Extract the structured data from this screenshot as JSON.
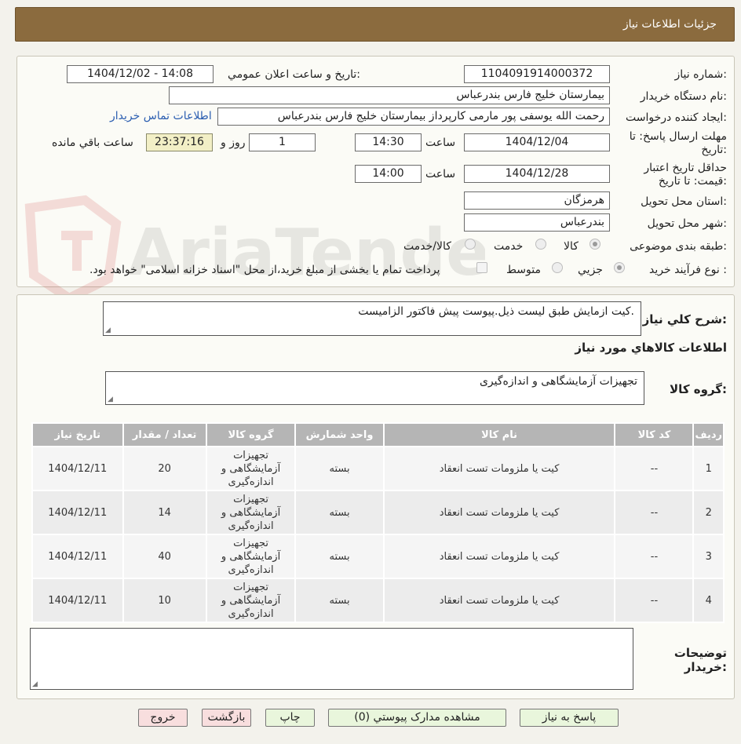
{
  "header": {
    "title": "جزئیات اطلاعات نیاز"
  },
  "form": {
    "need_number_label": "شماره نیاز:",
    "need_number": "1104091914000372",
    "announce_label": "تاریخ و ساعت اعلان عمومي:",
    "announce_value": "1404/12/02 - 14:08",
    "buyer_org_label": "نام دستگاه خريدار:",
    "buyer_org": "بیمارستان خلیج فارس بندرعباس",
    "creator_label": "ايجاد کننده درخواست:",
    "creator": "رحمت الله یوسفی پور مارمی کارپرداز بیمارستان خلیج فارس بندرعباس",
    "contact_link": "اطلاعات تماس خريدار",
    "deadline_label_line1": "مهلت ارسال پاسخ: تا",
    "deadline_label_line2": "تاريخ:",
    "deadline_date": "1404/12/04",
    "time_label": "ساعت",
    "deadline_time": "14:30",
    "days_value": "1",
    "days_label": "روز و",
    "remaining_time": "23:37:16",
    "remaining_label": "ساعت باقي مانده",
    "validity_label_line1": "حداقل تاريخ اعتبار",
    "validity_label_line2": "قيمت: تا تاريخ:",
    "validity_date": "1404/12/28",
    "validity_time": "14:00",
    "province_label": "استان محل تحويل:",
    "province": "هرمزگان",
    "city_label": "شهر محل تحويل:",
    "city": "بندرعباس",
    "category_label": "طبقه بندی موضوعی:",
    "category_options": [
      "کالا",
      "خدمت",
      "کالا/خدمت"
    ],
    "process_label": "نوع فرآيند خريد :",
    "process_options": [
      "جزيي",
      "متوسط"
    ],
    "payment_note": "پرداخت تمام يا بخشی از مبلغ خريد،از محل \"اسناد خزانه اسلامی\" خواهد بود."
  },
  "details": {
    "description_label": "شرح کلي نياز:",
    "description": "کیت ازمایش طبق لیست ذیل.پیوست پیش فاکتور الزامیست.",
    "goods_info_title": "اطلاعات کالاهاي مورد نياز",
    "goods_group_label": "گروه کالا:",
    "goods_group": "تجهیزات آزمایشگاهی و اندازه‌گیری",
    "table": {
      "headers": [
        "رديف",
        "کد کالا",
        "نام کالا",
        "واحد شمارش",
        "گروه کالا",
        "تعداد / مقدار",
        "تاريخ نياز"
      ],
      "rows": [
        [
          "1",
          "--",
          "کیت یا ملزومات تست انعقاد",
          "بسته",
          "تجهيزات آزمايشگاهی و اندازه‌گيری",
          "20",
          "1404/12/11"
        ],
        [
          "2",
          "--",
          "کیت یا ملزومات تست انعقاد",
          "بسته",
          "تجهيزات آزمايشگاهی و اندازه‌گيری",
          "14",
          "1404/12/11"
        ],
        [
          "3",
          "--",
          "کیت یا ملزومات تست انعقاد",
          "بسته",
          "تجهيزات آزمايشگاهی و اندازه‌گيری",
          "40",
          "1404/12/11"
        ],
        [
          "4",
          "--",
          "کیت یا ملزومات تست انعقاد",
          "بسته",
          "تجهيزات آزمايشگاهی و اندازه‌گيری",
          "10",
          "1404/12/11"
        ]
      ]
    },
    "buyer_notes_label_line1": "توضيحات",
    "buyer_notes_label_line2": "خريدار:",
    "buyer_notes": ""
  },
  "buttons": {
    "reply": "پاسخ به نياز",
    "view_docs": "مشاهده مدارک پيوستي (0)",
    "print": "چاپ",
    "back": "بازگشت",
    "exit": "خروج"
  },
  "watermark": {
    "text": "AriaTender.neT"
  },
  "colors": {
    "header_bg": "#8b6b3e",
    "link": "#2a5db0",
    "remaining_bg": "#f2efc6"
  }
}
